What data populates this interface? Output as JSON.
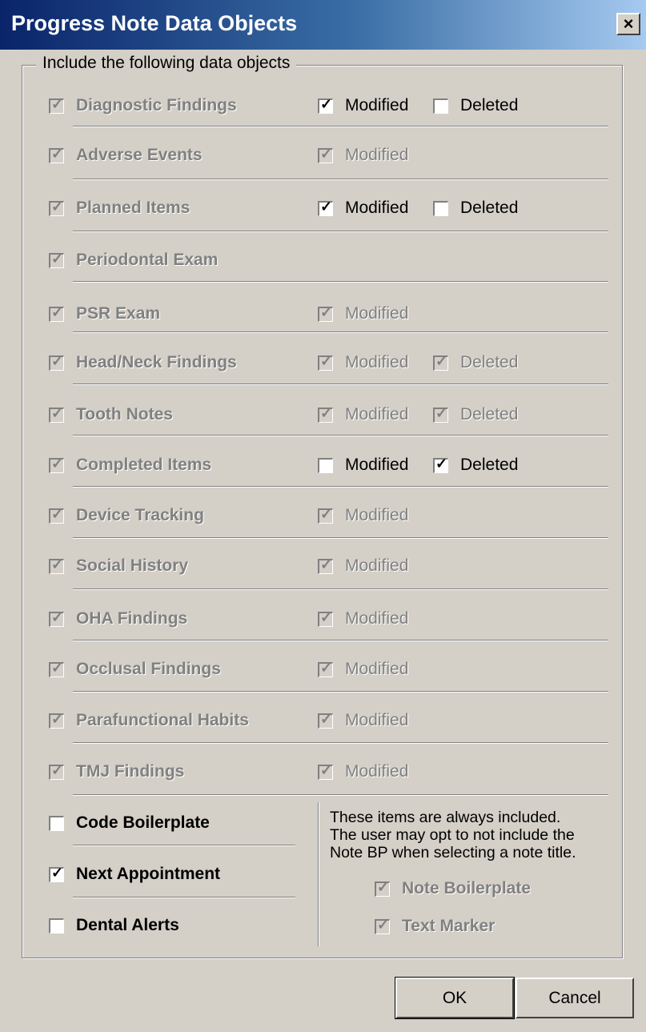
{
  "window": {
    "title": "Progress Note Data Objects",
    "close_glyph": "×"
  },
  "group": {
    "legend": "Include the following data objects"
  },
  "rows": [
    {
      "label": "Diagnostic Findings",
      "modified": {
        "label": "Modified",
        "checked": true,
        "enabled": true
      },
      "deleted": {
        "label": "Deleted",
        "checked": false,
        "enabled": true
      }
    },
    {
      "label": "Adverse Events",
      "modified": {
        "label": "Modified",
        "checked": true,
        "enabled": false
      }
    },
    {
      "label": "Planned Items",
      "modified": {
        "label": "Modified",
        "checked": true,
        "enabled": true
      },
      "deleted": {
        "label": "Deleted",
        "checked": false,
        "enabled": true
      }
    },
    {
      "label": "Periodontal Exam"
    },
    {
      "label": "PSR Exam",
      "modified": {
        "label": "Modified",
        "checked": true,
        "enabled": false
      }
    },
    {
      "label": "Head/Neck Findings",
      "modified": {
        "label": "Modified",
        "checked": true,
        "enabled": false
      },
      "deleted": {
        "label": "Deleted",
        "checked": true,
        "enabled": false
      }
    },
    {
      "label": "Tooth Notes",
      "modified": {
        "label": "Modified",
        "checked": true,
        "enabled": false
      },
      "deleted": {
        "label": "Deleted",
        "checked": true,
        "enabled": false
      }
    },
    {
      "label": "Completed Items",
      "modified": {
        "label": "Modified",
        "checked": false,
        "enabled": true
      },
      "deleted": {
        "label": "Deleted",
        "checked": true,
        "enabled": true
      }
    },
    {
      "label": "Device Tracking",
      "modified": {
        "label": "Modified",
        "checked": true,
        "enabled": false
      }
    },
    {
      "label": "Social History",
      "modified": {
        "label": "Modified",
        "checked": true,
        "enabled": false
      }
    },
    {
      "label": "OHA Findings",
      "modified": {
        "label": "Modified",
        "checked": true,
        "enabled": false
      }
    },
    {
      "label": "Occlusal Findings",
      "modified": {
        "label": "Modified",
        "checked": true,
        "enabled": false
      }
    },
    {
      "label": "Parafunctional Habits",
      "modified": {
        "label": "Modified",
        "checked": true,
        "enabled": false
      }
    },
    {
      "label": "TMJ Findings",
      "modified": {
        "label": "Modified",
        "checked": true,
        "enabled": false
      }
    }
  ],
  "extras": [
    {
      "label": "Code Boilerplate",
      "checked": false
    },
    {
      "label": "Next Appointment",
      "checked": true
    },
    {
      "label": "Dental Alerts",
      "checked": false
    }
  ],
  "always_note": {
    "line1": "These items are always included.",
    "line2": "The user may opt to not include the",
    "line3": "Note BP when selecting a note title."
  },
  "always_items": [
    {
      "label": "Note Boilerplate",
      "checked": true
    },
    {
      "label": "Text Marker",
      "checked": true
    }
  ],
  "buttons": {
    "ok": "OK",
    "cancel": "Cancel"
  },
  "colors": {
    "title_start": "#0a246a",
    "title_end": "#a6caf0",
    "face": "#d4d0c8",
    "disabled_text": "#808080"
  }
}
